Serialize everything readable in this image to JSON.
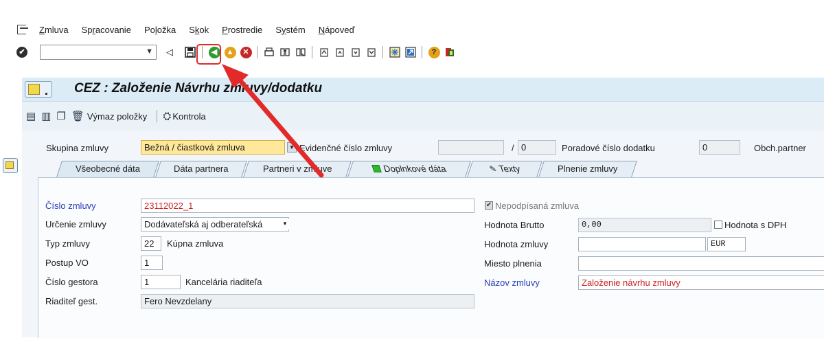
{
  "menu": {
    "items": [
      {
        "label": "Zmluva",
        "u": "Z",
        "rest": "mluva"
      },
      {
        "label": "Spracovanie",
        "pre": "Sp",
        "u": "r",
        "rest": "acovanie"
      },
      {
        "label": "Položka",
        "pre": "Po",
        "u": "l",
        "rest": "ožka"
      },
      {
        "label": "Skok",
        "pre": "S",
        "u": "k",
        "rest": "ok"
      },
      {
        "label": "Prostredie",
        "u": "P",
        "rest": "rostredie"
      },
      {
        "label": "Systém",
        "pre": "S",
        "u": "y",
        "rest": "stém"
      },
      {
        "label": "Nápoveď",
        "u": "N",
        "rest": "ápoveď"
      }
    ]
  },
  "toolbar": {
    "command_value": ""
  },
  "title": "CEZ : Založenie Návrhu zmluvy/dodatku",
  "apptoolbar": {
    "delete_item": "Výmaz položky",
    "check": "Kontrola"
  },
  "header": {
    "group_label": "Skupina zmluvy",
    "group_value": "Bežná / čiastková zmluva",
    "evid_label": "Evidenčné číslo zmluvy",
    "evid_value": "",
    "evid_sep": "/",
    "evid_sub": "0",
    "order_label": "Poradové číslo dodatku",
    "order_value": "0",
    "partner_label": "Obch.partner"
  },
  "tabs": [
    "Všeobecné dáta",
    "Dáta partnera",
    "Partneri v zmluve",
    "Doplnkové dáta",
    "Texty",
    "Plnenie zmluvy"
  ],
  "form": {
    "cislo_label": "Číslo zmluvy",
    "cislo_value": "23112022_1",
    "urcenie_label": "Určenie zmluvy",
    "urcenie_value": "Dodávateľská aj odberateľská",
    "typ_label": "Typ zmluvy",
    "typ_code": "22",
    "typ_text": "Kúpna zmluva",
    "postup_label": "Postup VO",
    "postup_value": "1",
    "gestor_label": "Číslo gestora",
    "gestor_value": "1",
    "gestor_text": "Kancelária riaditeľa",
    "riaditel_label": "Riaditeľ gest.",
    "riaditel_value": "Fero Nevzdelany",
    "nepodp_label": "Nepodpísaná zmluva",
    "brutto_label": "Hodnota Brutto",
    "brutto_value": "0,00",
    "dph_label": "Hodnota s DPH",
    "hodnota_label": "Hodnota zmluvy",
    "hodnota_value": "",
    "currency": "EUR",
    "miesto_label": "Miesto plnenia",
    "miesto_value": "",
    "nazov_label": "Názov zmluvy",
    "nazov_value": "Založenie návrhu zmluvy"
  },
  "colors": {
    "highlight": "#e22a2a",
    "required_label": "#2a3cb8",
    "red_value": "#cc2222"
  }
}
